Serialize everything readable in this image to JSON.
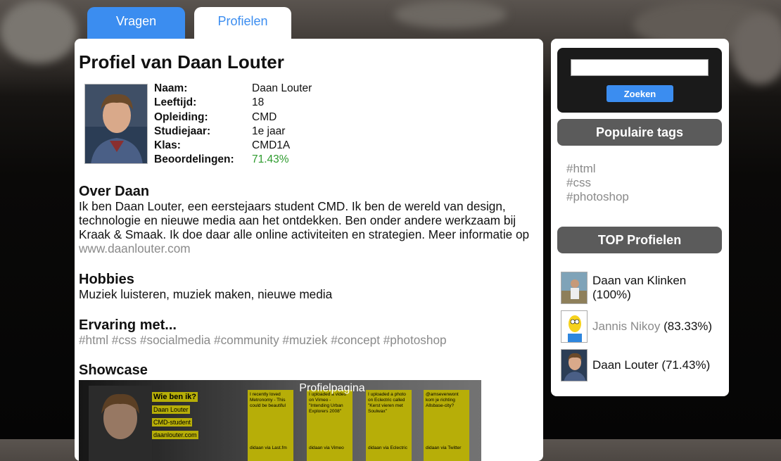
{
  "tabs": {
    "vragen": "Vragen",
    "profielen": "Profielen"
  },
  "profile": {
    "title": "Profiel van Daan Louter",
    "rows": [
      {
        "label": "Naam:",
        "value": "Daan Louter"
      },
      {
        "label": "Leeftijd:",
        "value": "18"
      },
      {
        "label": "Opleiding:",
        "value": "CMD"
      },
      {
        "label": "Studiejaar:",
        "value": "1e jaar"
      },
      {
        "label": "Klas:",
        "value": "CMD1A"
      },
      {
        "label": "Beoordelingen:",
        "value": "71.43%"
      }
    ],
    "about": {
      "heading": "Over Daan",
      "text": "Ik ben Daan Louter, een eerstejaars student CMD. Ik ben de wereld van design, technologie en nieuwe media aan het ontdekken. Ben onder andere werkzaam bij Kraak & Smaak. Ik doe daar alle online activiteiten en strategien. Meer informatie op ",
      "link": "www.daanlouter.com"
    },
    "hobbies": {
      "heading": "Hobbies",
      "text": "Muziek luisteren, muziek maken, nieuwe media"
    },
    "experience": {
      "heading": "Ervaring met...",
      "tags": "#html #css #socialmedia #community #muziek #concept #photoshop"
    },
    "showcase": {
      "heading": "Showcase",
      "overlay": "Profielpagina",
      "who_title": "Wie ben ik?",
      "who_lines": [
        "Daan Louter",
        "CMD-student",
        "daanlouter.com"
      ],
      "cards": [
        {
          "text": "I recently loved Metronomy - This could be beautiful",
          "source": "didaan via Last.fm"
        },
        {
          "text": "I uploaded a video on Vimeo - \"Intending Urban Explorers 2008\"",
          "source": "didaan via Vimeo"
        },
        {
          "text": "I uploaded a photo on Eclectric called \"Kerst vieren met Soulwax\"",
          "source": "didaan via Eclectric"
        },
        {
          "text": "@amsevenwont kom je richting Allsbase-city?",
          "source": "didaan via Twitter"
        }
      ]
    }
  },
  "sidebar": {
    "search_button": "Zoeken",
    "popular_header": "Populaire tags",
    "tags": [
      "#html",
      "#css",
      "#photoshop"
    ],
    "top_header": "TOP Profielen",
    "top": [
      {
        "name": "Daan van Klinken",
        "score": "(100%)"
      },
      {
        "name": "Jannis Nikoy",
        "score": "(83.33%)"
      },
      {
        "name": "Daan Louter",
        "score": "(71.43%)"
      }
    ]
  },
  "colors": {
    "accent": "#3b8df0",
    "rating": "#2e9b2e",
    "muted": "#8a8a8a",
    "header": "#5b5b5b"
  }
}
